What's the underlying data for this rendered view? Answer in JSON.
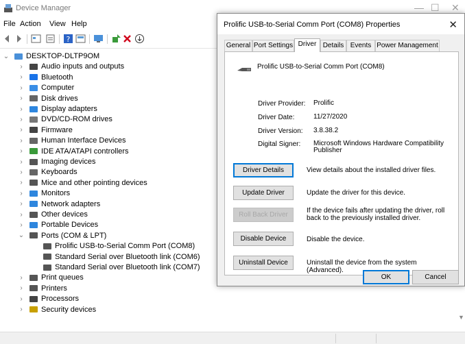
{
  "window": {
    "title": "Device Manager",
    "min_glyph": "—",
    "max_glyph": "☐",
    "close_glyph": "✕"
  },
  "menu": [
    "File",
    "Action",
    "View",
    "Help"
  ],
  "tree": {
    "root": "DESKTOP-DLTP9OM",
    "items": [
      {
        "label": "Audio inputs and outputs",
        "icon": "speaker-icon",
        "color": "#444"
      },
      {
        "label": "Bluetooth",
        "icon": "bluetooth-icon",
        "color": "#1a73e8"
      },
      {
        "label": "Computer",
        "icon": "computer-icon",
        "color": "#3a8ee6"
      },
      {
        "label": "Disk drives",
        "icon": "disk-drive-icon",
        "color": "#666"
      },
      {
        "label": "Display adapters",
        "icon": "display-adapter-icon",
        "color": "#2e86de"
      },
      {
        "label": "DVD/CD-ROM drives",
        "icon": "dvd-drive-icon",
        "color": "#777"
      },
      {
        "label": "Firmware",
        "icon": "firmware-icon",
        "color": "#444"
      },
      {
        "label": "Human Interface Devices",
        "icon": "hid-icon",
        "color": "#666"
      },
      {
        "label": "IDE ATA/ATAPI controllers",
        "icon": "ide-controller-icon",
        "color": "#3a9a3a"
      },
      {
        "label": "Imaging devices",
        "icon": "camera-icon",
        "color": "#555"
      },
      {
        "label": "Keyboards",
        "icon": "keyboard-icon",
        "color": "#666"
      },
      {
        "label": "Mice and other pointing devices",
        "icon": "mouse-icon",
        "color": "#555"
      },
      {
        "label": "Monitors",
        "icon": "monitor-icon",
        "color": "#2e86de"
      },
      {
        "label": "Network adapters",
        "icon": "network-adapter-icon",
        "color": "#2e86de"
      },
      {
        "label": "Other devices",
        "icon": "other-devices-icon",
        "color": "#555"
      },
      {
        "label": "Portable Devices",
        "icon": "portable-device-icon",
        "color": "#2e86de"
      },
      {
        "label": "Ports (COM & LPT)",
        "icon": "port-icon",
        "color": "#555",
        "expanded": true,
        "children": [
          "Prolific USB-to-Serial Comm Port (COM8)",
          "Standard Serial over Bluetooth link (COM6)",
          "Standard Serial over Bluetooth link (COM7)"
        ]
      },
      {
        "label": "Print queues",
        "icon": "print-queue-icon",
        "color": "#555"
      },
      {
        "label": "Printers",
        "icon": "printer-icon",
        "color": "#555"
      },
      {
        "label": "Processors",
        "icon": "processor-icon",
        "color": "#444"
      },
      {
        "label": "Security devices",
        "icon": "security-device-icon",
        "color": "#c8a000"
      }
    ]
  },
  "dialog": {
    "title": "Prolific USB-to-Serial Comm Port (COM8) Properties",
    "close_glyph": "✕",
    "tabs": [
      "General",
      "Port Settings",
      "Driver",
      "Details",
      "Events",
      "Power Management"
    ],
    "active_tab": "Driver",
    "device_name": "Prolific USB-to-Serial Comm Port (COM8)",
    "fields": [
      {
        "key": "Driver Provider:",
        "value": "Prolific"
      },
      {
        "key": "Driver Date:",
        "value": "11/27/2020"
      },
      {
        "key": "Driver Version:",
        "value": "3.8.38.2"
      },
      {
        "key": "Digital Signer:",
        "value": "Microsoft Windows Hardware Compatibility Publisher"
      }
    ],
    "actions": [
      {
        "label": "Driver Details",
        "desc": "View details about the installed driver files."
      },
      {
        "label": "Update Driver",
        "desc": "Update the driver for this device."
      },
      {
        "label": "Roll Back Driver",
        "desc": "If the device fails after updating the driver, roll back to the previously installed driver."
      },
      {
        "label": "Disable Device",
        "desc": "Disable the device."
      },
      {
        "label": "Uninstall Device",
        "desc": "Uninstall the device from the system (Advanced)."
      }
    ],
    "ok_label": "OK",
    "cancel_label": "Cancel"
  }
}
